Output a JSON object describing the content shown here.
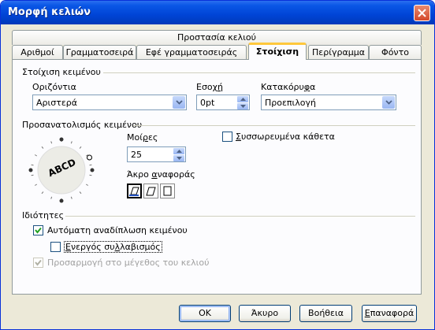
{
  "window": {
    "title": "Μορφή κελιών"
  },
  "tabs_top": [
    {
      "label": "Προστασία κελιού"
    }
  ],
  "tabs": [
    {
      "label": "Αριθμοί"
    },
    {
      "label": "Γραμματοσειρά"
    },
    {
      "label": "Εφέ γραμματοσειράς"
    },
    {
      "label": "Στοίχιση",
      "active": true
    },
    {
      "label": "Περίγραμμα"
    },
    {
      "label": "Φόντο"
    }
  ],
  "text_alignment": {
    "heading": "Στοίχιση κειμένου",
    "horizontal_label": "Οριζόντια",
    "horizontal_value": "Αριστερά",
    "indent_label": "Εσοχή",
    "indent_value": "0pt",
    "vertical_label": "Κατακόρυφα",
    "vertical_value": "Προεπιλογή"
  },
  "orientation": {
    "heading": "Προσανατολισμός κειμένου",
    "dial_text": "ABCD",
    "degrees_label": "Μοίρες",
    "degrees_value": "25",
    "reference_edge_label": "Άκρο αναφοράς",
    "stacked_label": "Συσσωρευμένα κάθετα",
    "stacked_checked": false
  },
  "properties": {
    "heading": "Ιδιότητες",
    "wrap_label": "Αυτόματη αναδίπλωση κειμένου",
    "wrap_checked": true,
    "hyphen_label": "Ενεργός συλλαβισμός",
    "hyphen_checked": false,
    "shrink_label": "Προσαρμογή στο μέγεθος του κελιού",
    "shrink_checked": true,
    "shrink_disabled": true
  },
  "buttons": {
    "ok": "OK",
    "cancel": "Άκυρο",
    "help": "Βοήθεια",
    "reset": "Επαναφορά"
  },
  "colors": {
    "titlebar": "#0a57e6",
    "tab_highlight": "#ffc83c",
    "dialog_bg": "#ece9d8"
  }
}
